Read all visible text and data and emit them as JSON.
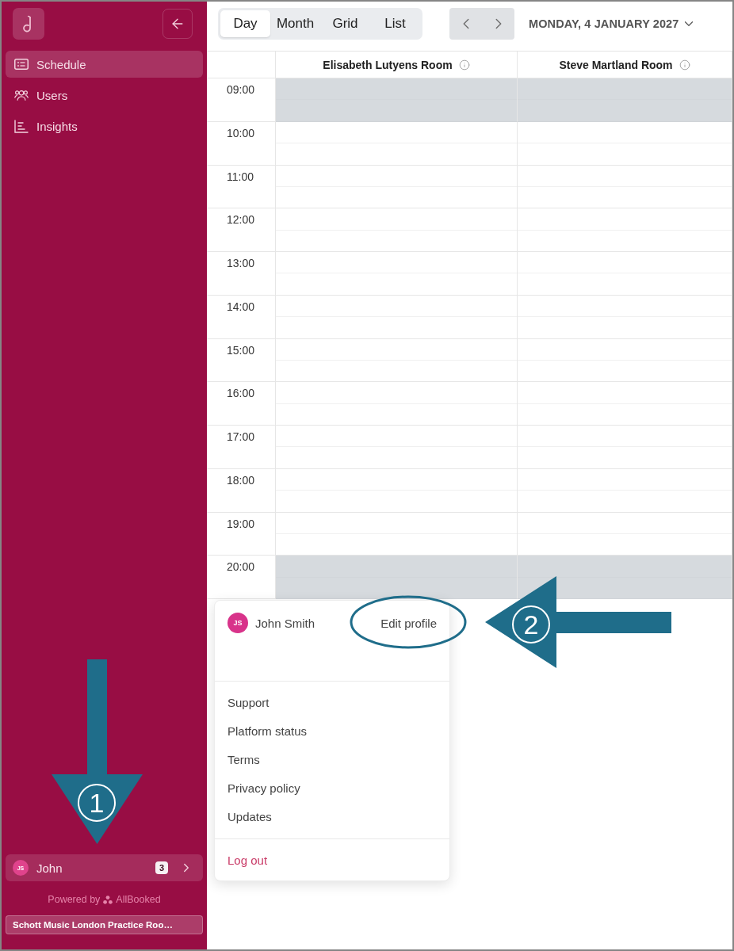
{
  "sidebar": {
    "items": [
      {
        "label": "Schedule",
        "selected": true
      },
      {
        "label": "Users",
        "selected": false
      },
      {
        "label": "Insights",
        "selected": false
      }
    ],
    "user": {
      "initials": "JS",
      "name": "John",
      "badge": "3"
    },
    "powered_by": {
      "prefix": "Powered by",
      "brand": "AllBooked"
    },
    "workspace": "Schott Music London Practice Roo…"
  },
  "toolbar": {
    "views": [
      {
        "label": "Day",
        "selected": true
      },
      {
        "label": "Month",
        "selected": false
      },
      {
        "label": "Grid",
        "selected": false
      },
      {
        "label": "List",
        "selected": false
      }
    ],
    "date": "MONDAY, 4 JANUARY 2027"
  },
  "calendar": {
    "rooms": [
      {
        "name": "Elisabeth Lutyens Room"
      },
      {
        "name": "Steve Martland Room"
      }
    ],
    "hours": [
      {
        "time": "09:00",
        "unavailable": true
      },
      {
        "time": "10:00",
        "unavailable": false
      },
      {
        "time": "11:00",
        "unavailable": false
      },
      {
        "time": "12:00",
        "unavailable": false
      },
      {
        "time": "13:00",
        "unavailable": false
      },
      {
        "time": "14:00",
        "unavailable": false
      },
      {
        "time": "15:00",
        "unavailable": false
      },
      {
        "time": "16:00",
        "unavailable": false
      },
      {
        "time": "17:00",
        "unavailable": false
      },
      {
        "time": "18:00",
        "unavailable": false
      },
      {
        "time": "19:00",
        "unavailable": false
      },
      {
        "time": "20:00",
        "unavailable": true
      }
    ]
  },
  "profile_menu": {
    "user": {
      "initials": "JS",
      "name": "John Smith"
    },
    "edit_profile": {
      "label": "Edit profile",
      "circled": true
    },
    "links": [
      "Support",
      "Platform status",
      "Terms",
      "Privacy policy",
      "Updates"
    ],
    "logout": "Log out"
  },
  "annotations": [
    {
      "kind": "arrow_down",
      "number": "1"
    },
    {
      "kind": "arrow_left",
      "number": "2"
    }
  ]
}
